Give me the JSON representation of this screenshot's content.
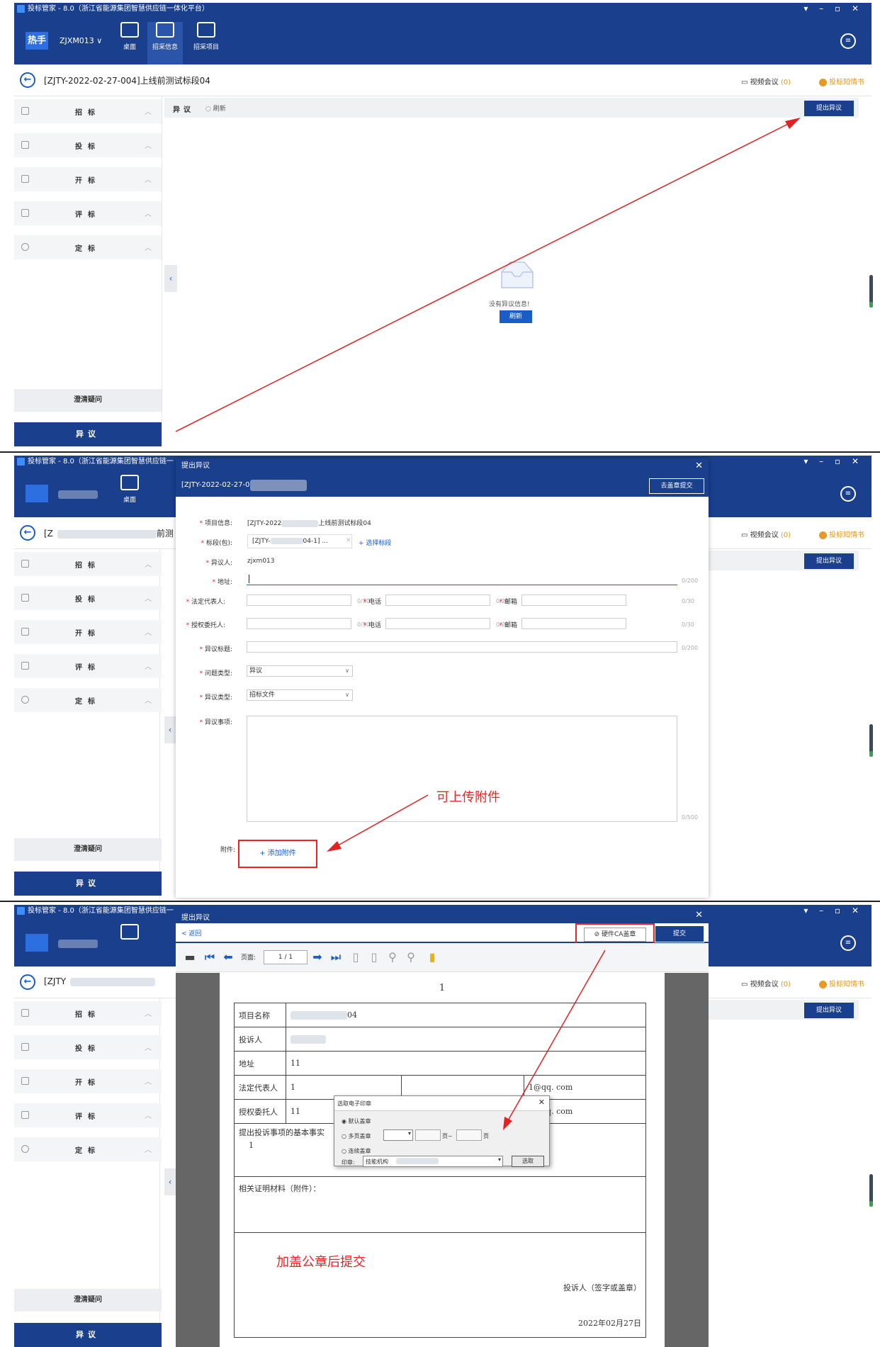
{
  "app": {
    "title": "投标管家 - 8.0（浙江省能源集团智慧供应链一体化平台）",
    "title_short": "投标管家 - 8.0（浙江省能源集团智慧供应链一",
    "window_controls": "▾ – ▫ ✕",
    "hot_label": "热手",
    "user": "ZJXM013 ∨",
    "nav": [
      {
        "label": "桌面",
        "icon": "desktop-icon"
      },
      {
        "label": "招采信息",
        "icon": "search-doc-icon"
      },
      {
        "label": "招采项目",
        "icon": "project-icon"
      }
    ],
    "colors": {
      "primary": "#1a3f8d",
      "accent": "#1a5cc8",
      "warn": "#e49a26",
      "annotation": "#e22222"
    }
  },
  "crumb": {
    "title": "[ZJTY-2022-02-27-004]上线前测试标段04",
    "title_p2": "[Z",
    "title_p2_tail": "前测",
    "title_p3": "[ZJTY",
    "video_label": "视频会议",
    "video_count": "(0)",
    "notice_label": "投标知情书"
  },
  "sidebar": {
    "items": [
      "招标",
      "投标",
      "开标",
      "评标",
      "定标"
    ],
    "clarify": "澄清疑问",
    "objection": "异议"
  },
  "panel1": {
    "toolbar_title": "异议",
    "refresh": "刷新",
    "submit_objection": "提出异议",
    "empty_text": "没有异议信息!",
    "empty_refresh": "刷新"
  },
  "panel2": {
    "dialog_title": "提出异议",
    "project_code": "[ZJTY-2022-02-27-0",
    "submit_without_seal": "去盖章提交",
    "fields": {
      "project_info_label": "项目信息:",
      "project_info_value_a": "[ZJTY-2022",
      "project_info_value_b": "上线前测试标段04",
      "section_label": "标段(包):",
      "section_value_a": "[ZJTY-",
      "section_value_b": "04-1] ...",
      "choose_section": "+ 选择标段",
      "objector_label": "异议人:",
      "objector_value": "zjxm013",
      "address_label": "地址:",
      "address_count": "0/200",
      "legal_rep_label": "法定代表人:",
      "legal_rep_count": "0/30",
      "phone_label": "电话",
      "phone_count": "0/20",
      "email_label": "邮箱",
      "email_count": "0/30",
      "agent_label": "授权委托人:",
      "agent_count": "0/30",
      "objection_title_label": "异议标题:",
      "objection_title_count": "0/200",
      "issue_type_label": "问题类型:",
      "issue_type_value": "异议",
      "objection_type_label": "异议类型:",
      "objection_type_value": "招标文件",
      "matter_label": "异议事项:",
      "matter_count": "0/500",
      "attachment_label": "附件:",
      "add_attachment": "+ 添加附件"
    },
    "annotation": "可上传附件"
  },
  "panel3": {
    "dialog_title": "提出异议",
    "back": "< 返回",
    "hardware_ca": "硬件CA盖章",
    "submit": "提交",
    "page_label": "页面:",
    "page_value": "1 / 1",
    "doc": {
      "page_no": "1",
      "rows": [
        {
          "label": "项目名称",
          "value": "04"
        },
        {
          "label": "投诉人",
          "value": ""
        },
        {
          "label": "地址",
          "value": "11"
        },
        {
          "label": "法定代表人",
          "value": "1",
          "extra": "1@qq. com"
        },
        {
          "label": "授权委托人",
          "value": "11",
          "extra": "1@qq. com"
        }
      ],
      "fact_label": "提出投诉事项的基本事实",
      "fact_value": "1",
      "evidence_label": "相关证明材料（附件）：",
      "signer": "投诉人（签字或盖章）",
      "date": "2022年02月27日"
    },
    "seal_dialog": {
      "title": "选取电子印章",
      "opt_default": "默认盖章",
      "opt_multi": "多页盖章",
      "page_from": "页~",
      "page_to": "页",
      "opt_continuous": "连续盖章",
      "seal_label": "印章:",
      "seal_value": "技能机构",
      "choose": "选取"
    },
    "annotation": "加盖公章后提交"
  }
}
